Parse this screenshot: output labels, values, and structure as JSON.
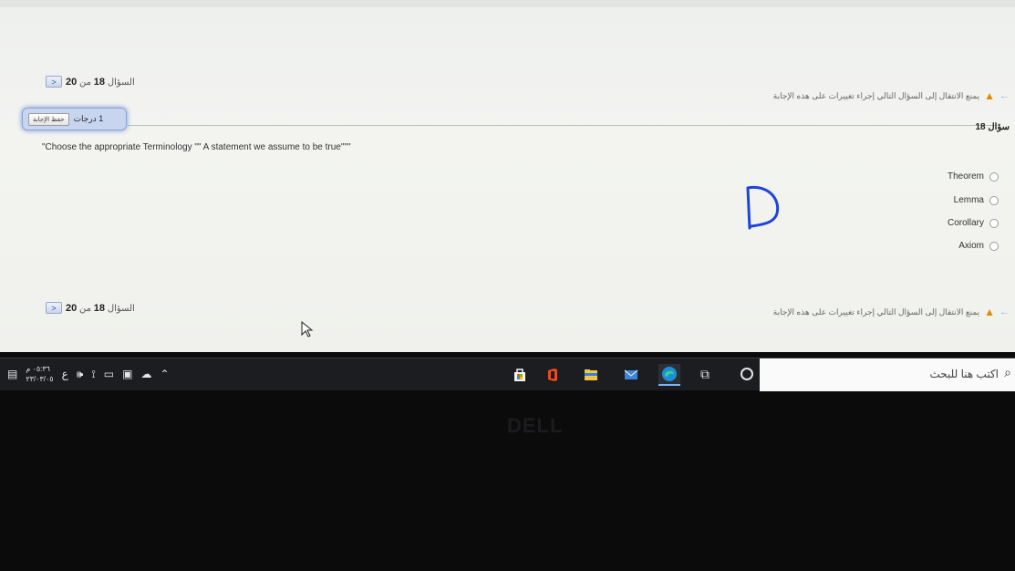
{
  "nav": {
    "question_label": "السؤال",
    "current": "18",
    "of": "من",
    "total": "20",
    "next_arrow": "<"
  },
  "warning": {
    "text": "يمنع الانتقال إلى السؤال التالي إجراء تغييرات على هذه الإجابة",
    "back_arrow": "←"
  },
  "grade": {
    "value": "1 درجات",
    "save_button": "حفظ الإجابة"
  },
  "question": {
    "label": "سؤال 18",
    "text": "\"Choose the appropriate Terminology \"\" A statement we assume to be true\"\"\"",
    "options": [
      "Theorem",
      "Lemma",
      "Corollary",
      "Axiom"
    ]
  },
  "taskbar": {
    "search_placeholder": "اكتب هنا للبحث",
    "time": "٠٥:٣٦ م",
    "date": "٢٣/٠٣/٠٥",
    "lang": "ع"
  },
  "brand": "DELL",
  "colors": {
    "accent": "#2f55d4",
    "warning": "#e58a00",
    "taskbar": "#1b1d20"
  }
}
